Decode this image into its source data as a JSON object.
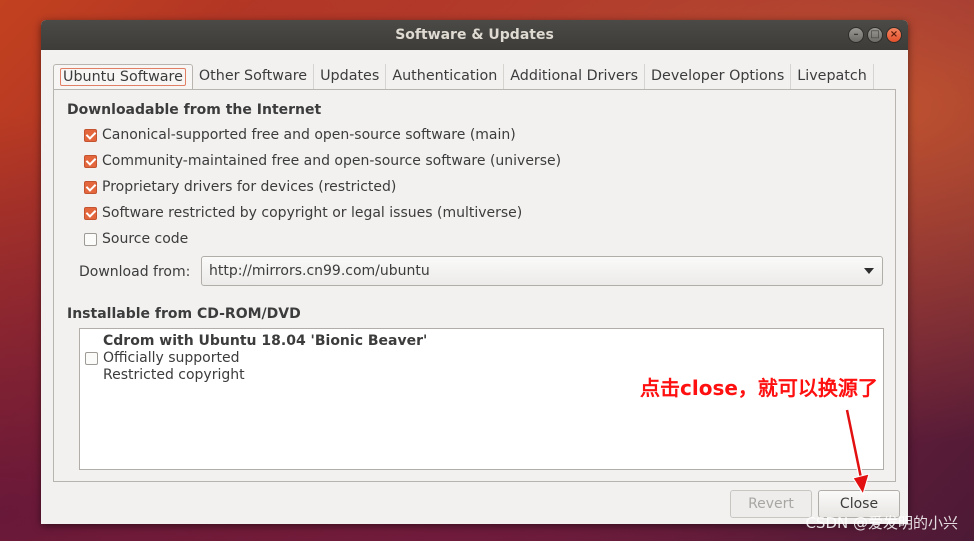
{
  "window": {
    "title": "Software & Updates",
    "controls": [
      "minimize-icon",
      "maximize-icon",
      "close-icon"
    ]
  },
  "tabs": [
    {
      "label": "Ubuntu Software",
      "active": true
    },
    {
      "label": "Other Software"
    },
    {
      "label": "Updates"
    },
    {
      "label": "Authentication"
    },
    {
      "label": "Additional Drivers"
    },
    {
      "label": "Developer Options"
    },
    {
      "label": "Livepatch"
    }
  ],
  "internet": {
    "heading": "Downloadable from the Internet",
    "options": [
      {
        "label": "Canonical-supported free and open-source software (main)",
        "checked": true
      },
      {
        "label": "Community-maintained free and open-source software (universe)",
        "checked": true
      },
      {
        "label": "Proprietary drivers for devices (restricted)",
        "checked": true
      },
      {
        "label": "Software restricted by copyright or legal issues (multiverse)",
        "checked": true
      },
      {
        "label": "Source code",
        "checked": false
      }
    ],
    "download_from_label": "Download from:",
    "download_from_value": "http://mirrors.cn99.com/ubuntu"
  },
  "cdrom": {
    "heading": "Installable from CD-ROM/DVD",
    "item": {
      "title": "Cdrom with Ubuntu 18.04 'Bionic Beaver'",
      "line2": "Officially supported",
      "line3": "Restricted copyright",
      "checked": false
    }
  },
  "buttons": {
    "revert": "Revert",
    "close": "Close"
  },
  "annotation": "点击close，就可以换源了",
  "watermark": "CSDN @爱发明的小兴",
  "colors": {
    "accent": "#e3663d",
    "annotation": "#ff1010",
    "titlebar": "#3d3c39"
  }
}
